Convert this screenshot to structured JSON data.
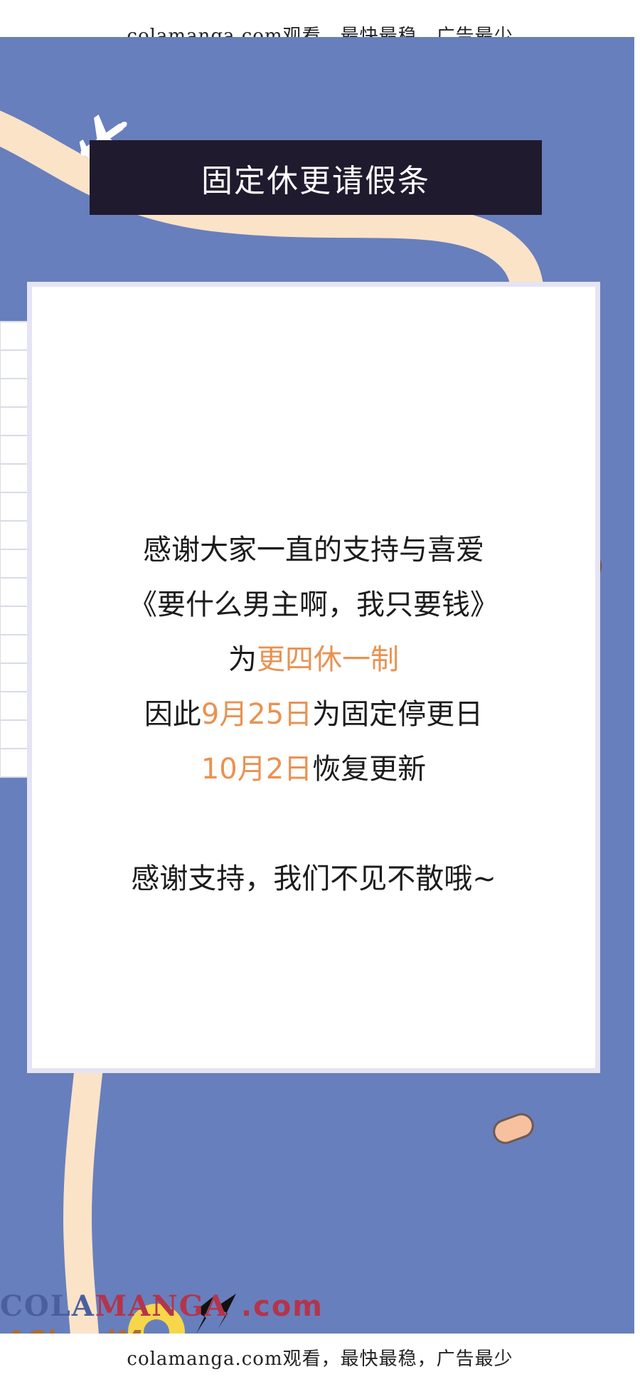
{
  "watermark": {
    "top": "colamanga.com观看，最快最稳，广告最少",
    "bottom": "colamanga.com观看，最快最稳，广告最少"
  },
  "banner": {
    "title": "固定休更请假条"
  },
  "notice": {
    "line1": "感谢大家一直的支持与喜爱",
    "line2": "《要什么男主啊，我只要钱》",
    "line3_prefix": "为",
    "line3_highlight": "更四休一制",
    "line4_prefix": "因此",
    "line4_highlight": "9月25日",
    "line4_suffix": "为固定停更日",
    "line5_highlight": "10月2日",
    "line5_suffix": "恢复更新",
    "line6": "感谢支持，我们不见不散哦~"
  },
  "brand": {
    "line1_part1": "COLA",
    "line1_part2": "MANGA",
    "line1_part3": ".com",
    "line2": "ACloudMerge.com"
  },
  "colors": {
    "background": "#687fbd",
    "banner": "#201a2e",
    "highlight": "#e99252",
    "path": "#fbe3c8"
  },
  "icons": [
    "airplane-icon",
    "map-pin-icon",
    "double-chevron-icon"
  ]
}
